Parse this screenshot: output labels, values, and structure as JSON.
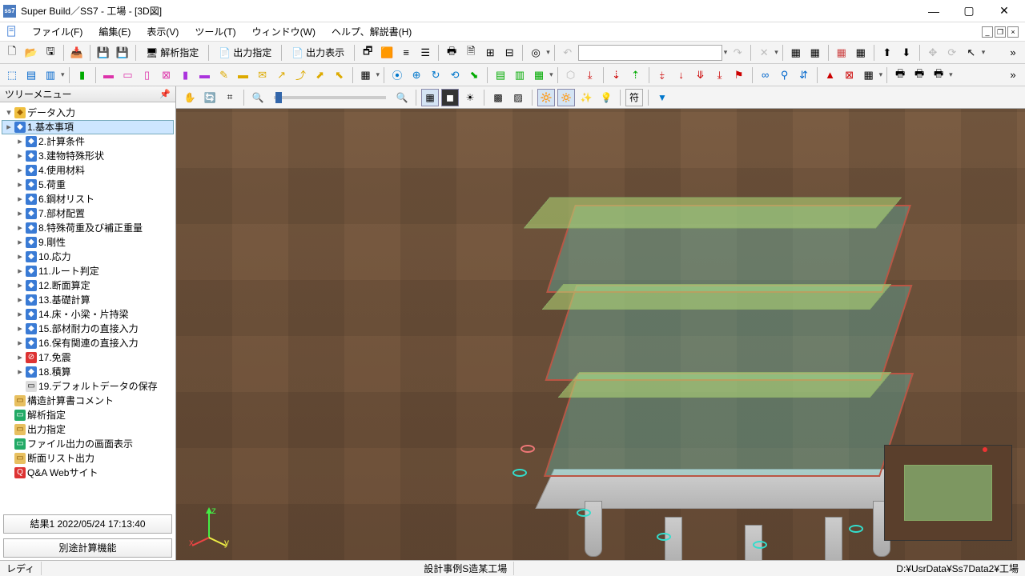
{
  "window": {
    "title": "Super Build／SS7 - 工場 - [3D図]"
  },
  "menus": [
    "ファイル(F)",
    "編集(E)",
    "表示(V)",
    "ツール(T)",
    "ウィンドウ(W)",
    "ヘルプ、解説書(H)"
  ],
  "toolbar1": {
    "analysis": "解析指定",
    "output_spec": "出力指定",
    "output_disp": "出力表示"
  },
  "tree": {
    "title": "ツリーメニュー",
    "root": "データ入力",
    "items": [
      {
        "label": "1.基本事項",
        "selected": true
      },
      {
        "label": "2.計算条件"
      },
      {
        "label": "3.建物特殊形状"
      },
      {
        "label": "4.使用材料"
      },
      {
        "label": "5.荷重"
      },
      {
        "label": "6.鋼材リスト"
      },
      {
        "label": "7.部材配置"
      },
      {
        "label": "8.特殊荷重及び補正重量"
      },
      {
        "label": "9.剛性"
      },
      {
        "label": "10.応力"
      },
      {
        "label": "11.ルート判定"
      },
      {
        "label": "12.断面算定"
      },
      {
        "label": "13.基礎計算"
      },
      {
        "label": "14.床・小梁・片持梁"
      },
      {
        "label": "15.部材耐力の直接入力"
      },
      {
        "label": "16.保有関連の直接入力"
      },
      {
        "label": "17.免震",
        "stop": true
      },
      {
        "label": "18.積算"
      },
      {
        "label": "19.デフォルトデータの保存",
        "leaf": true
      }
    ],
    "extra": [
      {
        "label": "構造計算書コメント",
        "ic": "doc"
      },
      {
        "label": "解析指定",
        "ic": "mon"
      },
      {
        "label": "出力指定",
        "ic": "doc"
      },
      {
        "label": "ファイル出力の画面表示",
        "ic": "mon"
      },
      {
        "label": "断面リスト出力",
        "ic": "doc"
      },
      {
        "label": "Q&A Webサイト",
        "ic": "qa"
      }
    ],
    "result_btn": "結果1  2022/05/24 17:13:40",
    "extra_btn": "別途計算機能"
  },
  "view_toolbar": {
    "fu": "符"
  },
  "status": {
    "ready": "レディ",
    "case": "設計事例S造某工場",
    "path": "D:¥UsrData¥Ss7Data2¥工場"
  }
}
